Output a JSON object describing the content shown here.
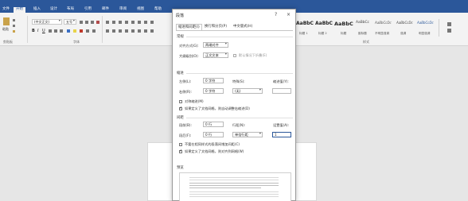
{
  "ribbon": {
    "tabs": [
      "文件",
      "开始",
      "插入",
      "设计",
      "布局",
      "引用",
      "邮件",
      "审阅",
      "视图",
      "帮助"
    ],
    "active_tab": "开始",
    "groups": {
      "clipboard": "剪贴板",
      "font": "字体",
      "styles": "样式"
    },
    "font_name": "(中文正文)",
    "font_size": "五号",
    "styles": [
      {
        "sample": "AaBbC",
        "name": "标题 1"
      },
      {
        "sample": "AaBbC",
        "name": "标题 2"
      },
      {
        "sample": "AaBbC",
        "name": "标题"
      },
      {
        "sample": "AaBbCc",
        "name": "副标题"
      },
      {
        "sample": "AaBbCcDc",
        "name": "不明显强调"
      },
      {
        "sample": "AaBbCcDc",
        "name": "强调"
      },
      {
        "sample": "AaBbCcDc",
        "name": "明显强调"
      }
    ],
    "left_labels": {
      "paste": "粘贴"
    }
  },
  "dialog": {
    "title": "段落",
    "help": "?",
    "close": "×",
    "tabs": [
      "缩进和间距(I)",
      "换行和分页(P)",
      "中文版式(H)"
    ],
    "general": {
      "heading": "常规",
      "alignment_label": "对齐方式(G):",
      "alignment_value": "两端对齐",
      "outline_label": "大纲级别(O):",
      "outline_value": "正文文本",
      "collapse_label": "默认情况下折叠(E)"
    },
    "indent": {
      "heading": "缩进",
      "left_label": "左侧(L):",
      "left_value": "0 字符",
      "right_label": "右侧(R):",
      "right_value": "0 字符",
      "special_label": "特殊(S):",
      "special_value": "(无)",
      "by_label": "缩进值(Y):",
      "by_value": "",
      "mirror_label": "对称缩进(M)",
      "auto_label": "如果定义了文档网格，则自动调整右缩进(D)"
    },
    "spacing": {
      "heading": "间距",
      "before_label": "段前(B):",
      "before_value": "0 行",
      "after_label": "段后(F):",
      "after_value": "0 行",
      "line_label": "行距(N):",
      "line_value": "单倍行距",
      "at_label": "设置值(A):",
      "at_value": "1",
      "no_space_label": "不要在相同样式的段落间增加间距(C)",
      "grid_label": "如果定义了文档网格，则对齐到网格(W)"
    },
    "preview": {
      "heading": "预览"
    }
  }
}
